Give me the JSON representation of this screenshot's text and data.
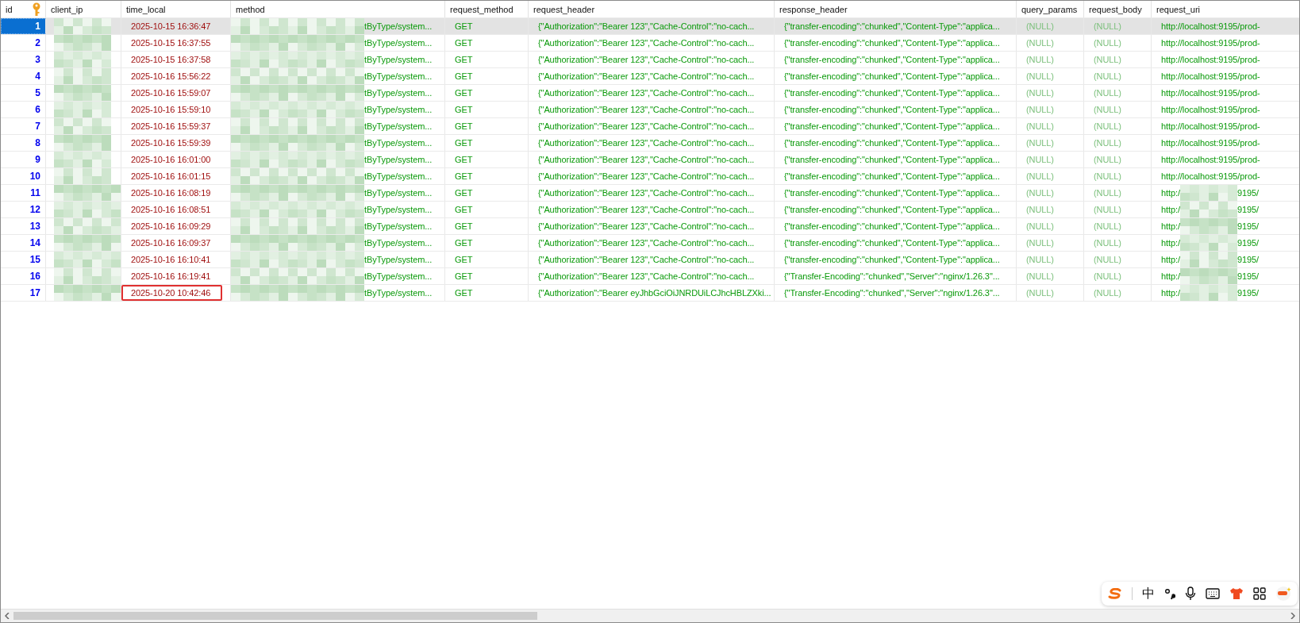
{
  "columns": [
    {
      "label": "id"
    },
    {
      "label": "client_ip"
    },
    {
      "label": "time_local"
    },
    {
      "label": "method"
    },
    {
      "label": "request_method"
    },
    {
      "label": "request_header"
    },
    {
      "label": "response_header"
    },
    {
      "label": "query_params"
    },
    {
      "label": "request_body"
    },
    {
      "label": "request_uri"
    }
  ],
  "rows": [
    {
      "id": "1",
      "selected": true,
      "marked": false,
      "time_local": "2025-10-15 16:36:47",
      "method": "tByType/system...",
      "request_method": "GET",
      "request_header": "{\"Authorization\":\"Bearer 123\",\"Cache-Control\":\"no-cach...",
      "response_header": "{\"transfer-encoding\":\"chunked\",\"Content-Type\":\"applica...",
      "query_params": "(NULL)",
      "request_body": "(NULL)",
      "request_uri": {
        "kind": "plain",
        "text": "http://localhost:9195/prod-"
      }
    },
    {
      "id": "2",
      "selected": false,
      "marked": false,
      "time_local": "2025-10-15 16:37:55",
      "method": "tByType/system...",
      "request_method": "GET",
      "request_header": "{\"Authorization\":\"Bearer 123\",\"Cache-Control\":\"no-cach...",
      "response_header": "{\"transfer-encoding\":\"chunked\",\"Content-Type\":\"applica...",
      "query_params": "(NULL)",
      "request_body": "(NULL)",
      "request_uri": {
        "kind": "plain",
        "text": "http://localhost:9195/prod-"
      }
    },
    {
      "id": "3",
      "selected": false,
      "marked": false,
      "time_local": "2025-10-15 16:37:58",
      "method": "tByType/system...",
      "request_method": "GET",
      "request_header": "{\"Authorization\":\"Bearer 123\",\"Cache-Control\":\"no-cach...",
      "response_header": "{\"transfer-encoding\":\"chunked\",\"Content-Type\":\"applica...",
      "query_params": "(NULL)",
      "request_body": "(NULL)",
      "request_uri": {
        "kind": "plain",
        "text": "http://localhost:9195/prod-"
      }
    },
    {
      "id": "4",
      "selected": false,
      "marked": false,
      "time_local": "2025-10-16 15:56:22",
      "method": "tByType/system...",
      "request_method": "GET",
      "request_header": "{\"Authorization\":\"Bearer 123\",\"Cache-Control\":\"no-cach...",
      "response_header": "{\"transfer-encoding\":\"chunked\",\"Content-Type\":\"applica...",
      "query_params": "(NULL)",
      "request_body": "(NULL)",
      "request_uri": {
        "kind": "plain",
        "text": "http://localhost:9195/prod-"
      }
    },
    {
      "id": "5",
      "selected": false,
      "marked": false,
      "time_local": "2025-10-16 15:59:07",
      "method": "tByType/system...",
      "request_method": "GET",
      "request_header": "{\"Authorization\":\"Bearer 123\",\"Cache-Control\":\"no-cach...",
      "response_header": "{\"transfer-encoding\":\"chunked\",\"Content-Type\":\"applica...",
      "query_params": "(NULL)",
      "request_body": "(NULL)",
      "request_uri": {
        "kind": "plain",
        "text": "http://localhost:9195/prod-"
      }
    },
    {
      "id": "6",
      "selected": false,
      "marked": false,
      "time_local": "2025-10-16 15:59:10",
      "method": "tByType/system...",
      "request_method": "GET",
      "request_header": "{\"Authorization\":\"Bearer 123\",\"Cache-Control\":\"no-cach...",
      "response_header": "{\"transfer-encoding\":\"chunked\",\"Content-Type\":\"applica...",
      "query_params": "(NULL)",
      "request_body": "(NULL)",
      "request_uri": {
        "kind": "plain",
        "text": "http://localhost:9195/prod-"
      }
    },
    {
      "id": "7",
      "selected": false,
      "marked": false,
      "time_local": "2025-10-16 15:59:37",
      "method": "tByType/system...",
      "request_method": "GET",
      "request_header": "{\"Authorization\":\"Bearer 123\",\"Cache-Control\":\"no-cach...",
      "response_header": "{\"transfer-encoding\":\"chunked\",\"Content-Type\":\"applica...",
      "query_params": "(NULL)",
      "request_body": "(NULL)",
      "request_uri": {
        "kind": "plain",
        "text": "http://localhost:9195/prod-"
      }
    },
    {
      "id": "8",
      "selected": false,
      "marked": false,
      "time_local": "2025-10-16 15:59:39",
      "method": "tByType/system...",
      "request_method": "GET",
      "request_header": "{\"Authorization\":\"Bearer 123\",\"Cache-Control\":\"no-cach...",
      "response_header": "{\"transfer-encoding\":\"chunked\",\"Content-Type\":\"applica...",
      "query_params": "(NULL)",
      "request_body": "(NULL)",
      "request_uri": {
        "kind": "plain",
        "text": "http://localhost:9195/prod-"
      }
    },
    {
      "id": "9",
      "selected": false,
      "marked": false,
      "time_local": "2025-10-16 16:01:00",
      "method": "tByType/system...",
      "request_method": "GET",
      "request_header": "{\"Authorization\":\"Bearer 123\",\"Cache-Control\":\"no-cach...",
      "response_header": "{\"transfer-encoding\":\"chunked\",\"Content-Type\":\"applica...",
      "query_params": "(NULL)",
      "request_body": "(NULL)",
      "request_uri": {
        "kind": "plain",
        "text": "http://localhost:9195/prod-"
      }
    },
    {
      "id": "10",
      "selected": false,
      "marked": false,
      "time_local": "2025-10-16 16:01:15",
      "method": "tByType/system...",
      "request_method": "GET",
      "request_header": "{\"Authorization\":\"Bearer 123\",\"Cache-Control\":\"no-cach...",
      "response_header": "{\"transfer-encoding\":\"chunked\",\"Content-Type\":\"applica...",
      "query_params": "(NULL)",
      "request_body": "(NULL)",
      "request_uri": {
        "kind": "plain",
        "text": "http://localhost:9195/prod-"
      }
    },
    {
      "id": "11",
      "selected": false,
      "marked": false,
      "time_local": "2025-10-16 16:08:19",
      "method": "tByType/system...",
      "request_method": "GET",
      "request_header": "{\"Authorization\":\"Bearer 123\",\"Cache-Control\":\"no-cach...",
      "response_header": "{\"transfer-encoding\":\"chunked\",\"Content-Type\":\"applica...",
      "query_params": "(NULL)",
      "request_body": "(NULL)",
      "request_uri": {
        "kind": "redacted",
        "start": "http:/",
        "end": "9195/"
      }
    },
    {
      "id": "12",
      "selected": false,
      "marked": false,
      "time_local": "2025-10-16 16:08:51",
      "method": "tByType/system...",
      "request_method": "GET",
      "request_header": "{\"Authorization\":\"Bearer 123\",\"Cache-Control\":\"no-cach...",
      "response_header": "{\"transfer-encoding\":\"chunked\",\"Content-Type\":\"applica...",
      "query_params": "(NULL)",
      "request_body": "(NULL)",
      "request_uri": {
        "kind": "redacted",
        "start": "http:/",
        "end": "9195/"
      }
    },
    {
      "id": "13",
      "selected": false,
      "marked": false,
      "time_local": "2025-10-16 16:09:29",
      "method": "tByType/system...",
      "request_method": "GET",
      "request_header": "{\"Authorization\":\"Bearer 123\",\"Cache-Control\":\"no-cach...",
      "response_header": "{\"transfer-encoding\":\"chunked\",\"Content-Type\":\"applica...",
      "query_params": "(NULL)",
      "request_body": "(NULL)",
      "request_uri": {
        "kind": "redacted",
        "start": "http:/",
        "end": "9195/"
      }
    },
    {
      "id": "14",
      "selected": false,
      "marked": false,
      "time_local": "2025-10-16 16:09:37",
      "method": "tByType/system...",
      "request_method": "GET",
      "request_header": "{\"Authorization\":\"Bearer 123\",\"Cache-Control\":\"no-cach...",
      "response_header": "{\"transfer-encoding\":\"chunked\",\"Content-Type\":\"applica...",
      "query_params": "(NULL)",
      "request_body": "(NULL)",
      "request_uri": {
        "kind": "redacted",
        "start": "http:/",
        "end": "9195/"
      }
    },
    {
      "id": "15",
      "selected": false,
      "marked": false,
      "time_local": "2025-10-16 16:10:41",
      "method": "tByType/system...",
      "request_method": "GET",
      "request_header": "{\"Authorization\":\"Bearer 123\",\"Cache-Control\":\"no-cach...",
      "response_header": "{\"transfer-encoding\":\"chunked\",\"Content-Type\":\"applica...",
      "query_params": "(NULL)",
      "request_body": "(NULL)",
      "request_uri": {
        "kind": "redacted",
        "start": "http:/",
        "end": "9195/"
      }
    },
    {
      "id": "16",
      "selected": false,
      "marked": false,
      "time_local": "2025-10-16 16:19:41",
      "method": "tByType/system...",
      "request_method": "GET",
      "request_header": "{\"Authorization\":\"Bearer 123\",\"Cache-Control\":\"no-cach...",
      "response_header": "{\"Transfer-Encoding\":\"chunked\",\"Server\":\"nginx/1.26.3\"...",
      "query_params": "(NULL)",
      "request_body": "(NULL)",
      "request_uri": {
        "kind": "redacted",
        "start": "http:/",
        "end": "9195/"
      }
    },
    {
      "id": "17",
      "selected": false,
      "marked": true,
      "time_local": "2025-10-20 10:42:46",
      "method": "tByType/system...",
      "request_method": "GET",
      "request_header": "{\"Authorization\":\"Bearer eyJhbGciOiJNRDUiLCJhcHBLZXki...",
      "response_header": "{\"Transfer-Encoding\":\"chunked\",\"Server\":\"nginx/1.26.3\"...",
      "query_params": "(NULL)",
      "request_body": "(NULL)",
      "request_uri": {
        "kind": "redacted",
        "start": "http:/",
        "end": "9195/"
      }
    }
  ],
  "ime_toolbar": {
    "mode": "中"
  }
}
